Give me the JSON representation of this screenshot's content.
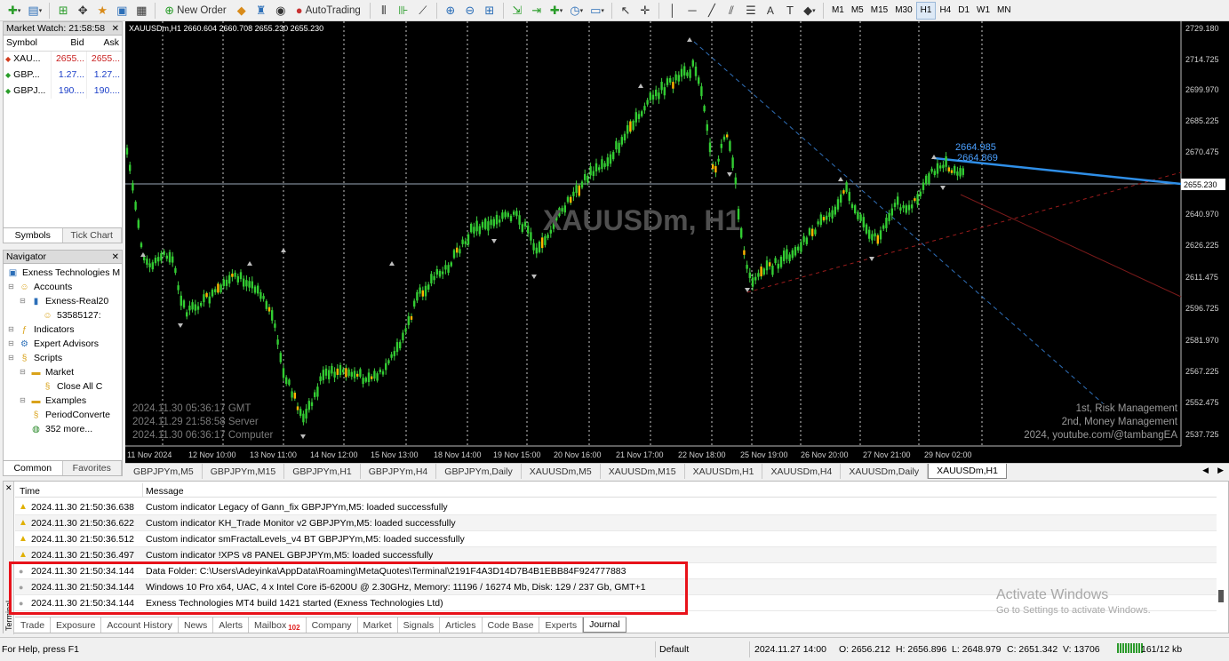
{
  "toolbar": {
    "new_order": "New Order",
    "autotrading": "AutoTrading",
    "timeframes": [
      "M1",
      "M5",
      "M15",
      "M30",
      "H1",
      "H4",
      "D1",
      "W1",
      "MN"
    ],
    "active_timeframe": "H1",
    "text_tool": "A"
  },
  "market_watch": {
    "title": "Market Watch: 21:58:58",
    "columns": [
      "Symbol",
      "Bid",
      "Ask"
    ],
    "rows": [
      {
        "symbol": "XAU...",
        "bid": "2655...",
        "ask": "2655...",
        "direction": "down"
      },
      {
        "symbol": "GBP...",
        "bid": "1.27...",
        "ask": "1.27...",
        "direction": "up"
      },
      {
        "symbol": "GBPJ...",
        "bid": "190....",
        "ask": "190....",
        "direction": "up"
      }
    ],
    "tabs": [
      "Symbols",
      "Tick Chart"
    ],
    "active_tab": "Symbols"
  },
  "navigator": {
    "title": "Navigator",
    "items": [
      {
        "label": "Exness Technologies M",
        "icon": "terminal-icon"
      },
      {
        "label": "Accounts",
        "icon": "accounts-icon"
      },
      {
        "label": "Exness-Real20",
        "icon": "server-icon"
      },
      {
        "label": "53585127:",
        "icon": "account-icon"
      },
      {
        "label": "Indicators",
        "icon": "indicators-icon"
      },
      {
        "label": "Expert Advisors",
        "icon": "expert-advisors-icon"
      },
      {
        "label": "Scripts",
        "icon": "scripts-icon"
      },
      {
        "label": "Market",
        "icon": "folder-icon"
      },
      {
        "label": "Close All C",
        "icon": "script-icon"
      },
      {
        "label": "Examples",
        "icon": "folder-icon"
      },
      {
        "label": "PeriodConverte",
        "icon": "script-icon"
      },
      {
        "label": "352 more...",
        "icon": "globe-icon"
      }
    ],
    "tabs": [
      "Common",
      "Favorites"
    ],
    "active_tab": "Common"
  },
  "chart": {
    "title": "XAUUSDm,H1  2660.604 2660.708 2655.230 2655.230",
    "watermark": "XAUUSDm, H1",
    "current_price": "2655.230",
    "price_ticks": [
      "2729.180",
      "2714.725",
      "2699.970",
      "2685.225",
      "2670.475",
      "2640.970",
      "2626.225",
      "2611.475",
      "2596.725",
      "2581.970",
      "2567.225",
      "2552.475",
      "2537.725"
    ],
    "date_ticks": [
      "11 Nov 2024",
      "12 Nov 10:00",
      "13 Nov 11:00",
      "14 Nov 12:00",
      "15 Nov 13:00",
      "18 Nov 14:00",
      "19 Nov 15:00",
      "20 Nov 16:00",
      "21 Nov 17:00",
      "22 Nov 18:00",
      "25 Nov 19:00",
      "26 Nov 20:00",
      "27 Nov 21:00",
      "29 Nov 02:00"
    ],
    "fibo_labels": [
      "2664.985",
      "2664.869"
    ],
    "time_lines": [
      "2024.11.30 05:36:17 GMT",
      "2024.11.29 21:58:58 Server",
      "2024.11.30 06:36:17 Computer"
    ],
    "credit_lines": [
      "1st, Risk Management",
      "2nd, Money Management",
      "2024, youtube.com/@tambangEA"
    ],
    "colors": {
      "background": "#000000",
      "bull": "#32cd32",
      "bear_highlight": "#ffb400",
      "trend_blue": "#2f8fe8",
      "trend_red": "#8b1c1c"
    }
  },
  "symbol_tabs": {
    "items": [
      "GBPJPYm,M5",
      "GBPJPYm,M15",
      "GBPJPYm,H1",
      "GBPJPYm,H4",
      "GBPJPYm,Daily",
      "XAUUSDm,M5",
      "XAUUSDm,M15",
      "XAUUSDm,H1",
      "XAUUSDm,H4",
      "XAUUSDm,Daily",
      "XAUUSDm,H1"
    ],
    "active_index": 10
  },
  "journal": {
    "side_label": "Terminal",
    "columns": [
      "Time",
      "Message"
    ],
    "rows": [
      {
        "type": "warning",
        "time": "2024.11.30 21:50:36.638",
        "message": "Custom indicator Legacy of Gann_fix GBPJPYm,M5: loaded successfully"
      },
      {
        "type": "warning",
        "time": "2024.11.30 21:50:36.622",
        "message": "Custom indicator KH_Trade Monitor v2 GBPJPYm,M5: loaded successfully"
      },
      {
        "type": "warning",
        "time": "2024.11.30 21:50:36.512",
        "message": "Custom indicator smFractalLevels_v4 BT GBPJPYm,M5: loaded successfully"
      },
      {
        "type": "warning",
        "time": "2024.11.30 21:50:36.497",
        "message": "Custom indicator !XPS v8 PANEL GBPJPYm,M5: loaded successfully"
      },
      {
        "type": "info",
        "time": "2024.11.30 21:50:34.144",
        "message": "Data Folder: C:\\Users\\Adeyinka\\AppData\\Roaming\\MetaQuotes\\Terminal\\2191F4A3D14D7B4B1EBB84F924777883"
      },
      {
        "type": "info",
        "time": "2024.11.30 21:50:34.144",
        "message": "Windows 10 Pro x64, UAC, 4 x Intel Core i5-6200U  @ 2.30GHz, Memory: 11196 / 16274 Mb, Disk: 129 / 237 Gb, GMT+1"
      },
      {
        "type": "info",
        "time": "2024.11.30 21:50:34.144",
        "message": "Exness Technologies MT4 build 1421 started (Exness Technologies Ltd)"
      }
    ],
    "tabs": [
      "Trade",
      "Exposure",
      "Account History",
      "News",
      "Alerts",
      "Mailbox",
      "Company",
      "Market",
      "Signals",
      "Articles",
      "Code Base",
      "Experts",
      "Journal"
    ],
    "mailbox_badge": "102",
    "active_tab": "Journal",
    "highlight_color": "#e8121a"
  },
  "windows_watermark": {
    "line1": "Activate Windows",
    "line2": "Go to Settings to activate Windows."
  },
  "status_bar": {
    "help": "For Help, press F1",
    "profile": "Default",
    "datetime": "2024.11.27 14:00",
    "open": "O: 2656.212",
    "high": "H: 2656.896",
    "low": "L: 2648.979",
    "close": "C: 2651.342",
    "volume": "V: 13706",
    "traffic": "161/12 kb"
  }
}
